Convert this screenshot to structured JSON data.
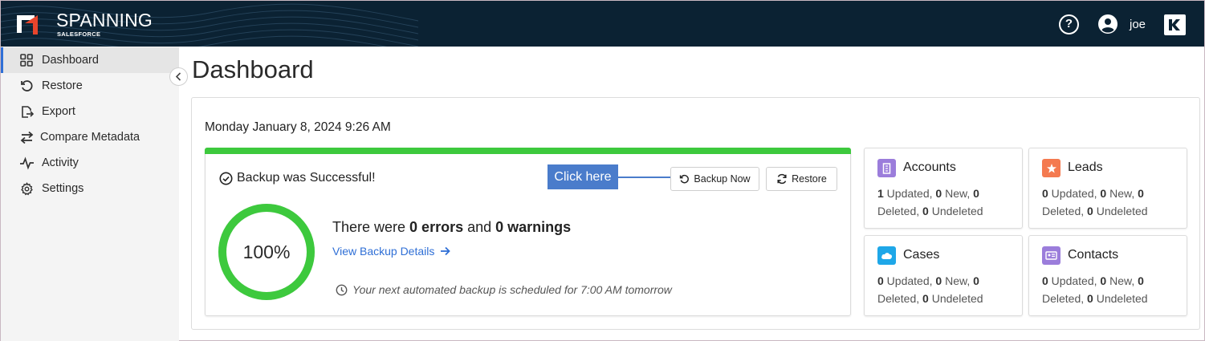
{
  "app": {
    "brand": "SPANNING",
    "brand_sub": "SALESFORCE",
    "user_name": "joe",
    "help_glyph": "?",
    "colors": {
      "header_bg": "#0b2233",
      "accent": "#2f6fd6",
      "success": "#3dc93d"
    }
  },
  "sidebar": {
    "items": [
      {
        "label": "Dashboard",
        "icon": "dashboard-grid-icon",
        "active": true
      },
      {
        "label": "Restore",
        "icon": "restore-icon"
      },
      {
        "label": "Export",
        "icon": "export-icon"
      },
      {
        "label": "Compare Metadata",
        "icon": "compare-arrows-icon"
      },
      {
        "label": "Activity",
        "icon": "activity-pulse-icon"
      },
      {
        "label": "Settings",
        "icon": "gear-icon"
      }
    ]
  },
  "main": {
    "title": "Dashboard",
    "datetime": "Monday January 8, 2024 9:26 AM",
    "backup": {
      "status": "Backup was Successful!",
      "callout": "Click here",
      "backup_now_label": "Backup Now",
      "restore_label": "Restore",
      "progress_percent": 100,
      "progress_label": "100%",
      "errors_prefix": "There were ",
      "errors_count": "0 errors",
      "errors_mid": " and ",
      "warnings_count": "0 warnings",
      "details_link": "View Backup Details",
      "schedule": "Your next automated backup is scheduled for 7:00 AM tomorrow"
    },
    "objects": [
      {
        "name": "Accounts",
        "updated": "1",
        "new": "0",
        "deleted": "0",
        "undeleted": "0",
        "color": "#9b7ddb",
        "icon": "building-icon"
      },
      {
        "name": "Leads",
        "updated": "0",
        "new": "0",
        "deleted": "0",
        "undeleted": "0",
        "color": "#f47a50",
        "icon": "star-person-icon"
      },
      {
        "name": "Cases",
        "updated": "0",
        "new": "0",
        "deleted": "0",
        "undeleted": "0",
        "color": "#1ea7e8",
        "icon": "cloud-icon"
      },
      {
        "name": "Contacts",
        "updated": "0",
        "new": "0",
        "deleted": "0",
        "undeleted": "0",
        "color": "#9b7ddb",
        "icon": "contact-card-icon"
      }
    ],
    "stat_labels": {
      "updated": " Updated, ",
      "new": " New, ",
      "deleted": "Deleted, ",
      "undeleted": " Undeleted"
    }
  }
}
